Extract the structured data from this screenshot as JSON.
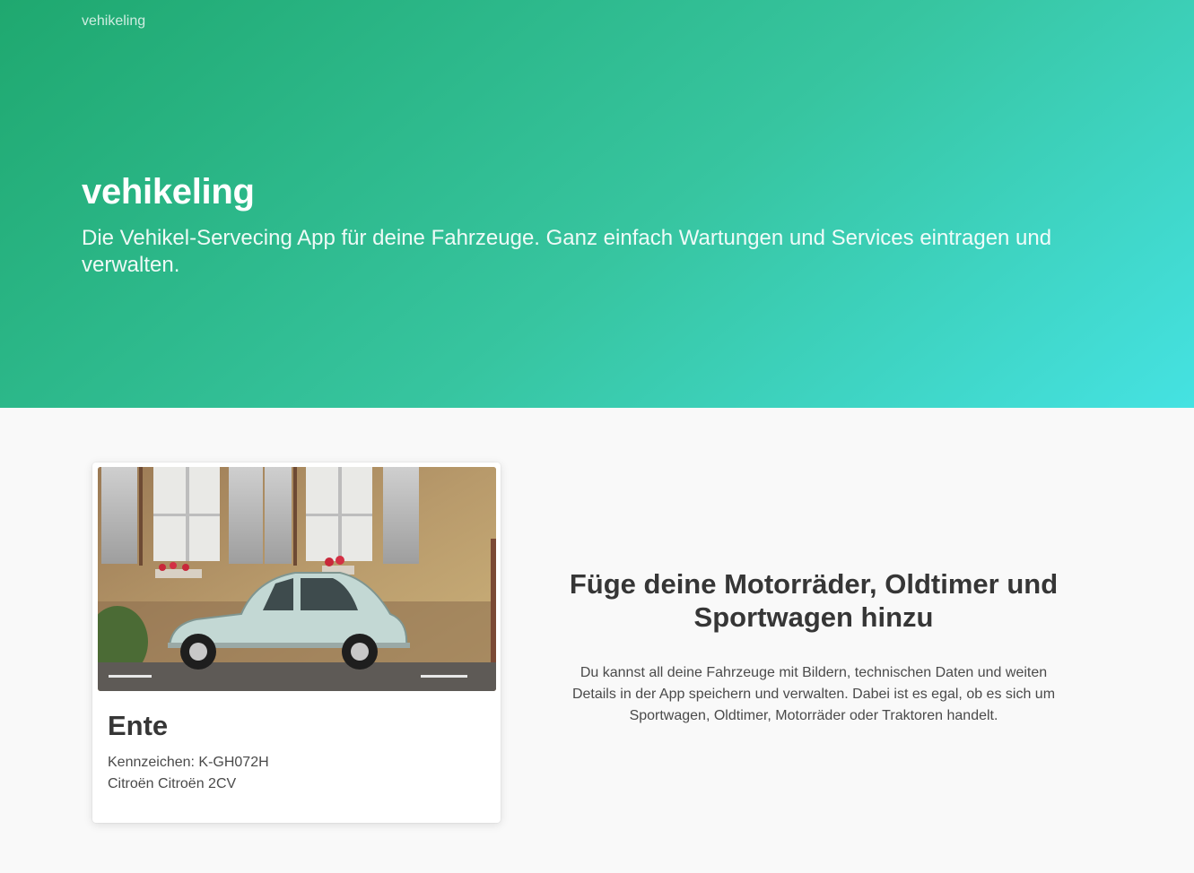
{
  "hero": {
    "brand": "vehikeling",
    "title": "vehikeling",
    "subtitle": "Die Vehikel-Servecing App für deine Fahrzeuge. Ganz einfach Wartungen und Services eintragen und verwalten."
  },
  "vehicle_card": {
    "image_icon": "vehicle-photo-citroen-2cv",
    "name": "Ente",
    "plate": "Kennzeichen: K-GH072H",
    "model": "Citroën Citroën 2CV"
  },
  "feature": {
    "heading": "Füge deine Motorräder, Oldtimer und Sportwagen hinzu",
    "text": "Du kannst all deine Fahrzeuge mit Bildern, technischen Daten und weiten Details in der App speichern und verwalten. Dabei ist es egal, ob es sich um Sportwagen, Oldtimer, Motorräder oder Traktoren handelt."
  },
  "colors": {
    "hero_gradient_start": "#1fa86f",
    "hero_gradient_end": "#45e2e2",
    "page_background": "#f9f9f9",
    "text_dark": "#363636"
  }
}
